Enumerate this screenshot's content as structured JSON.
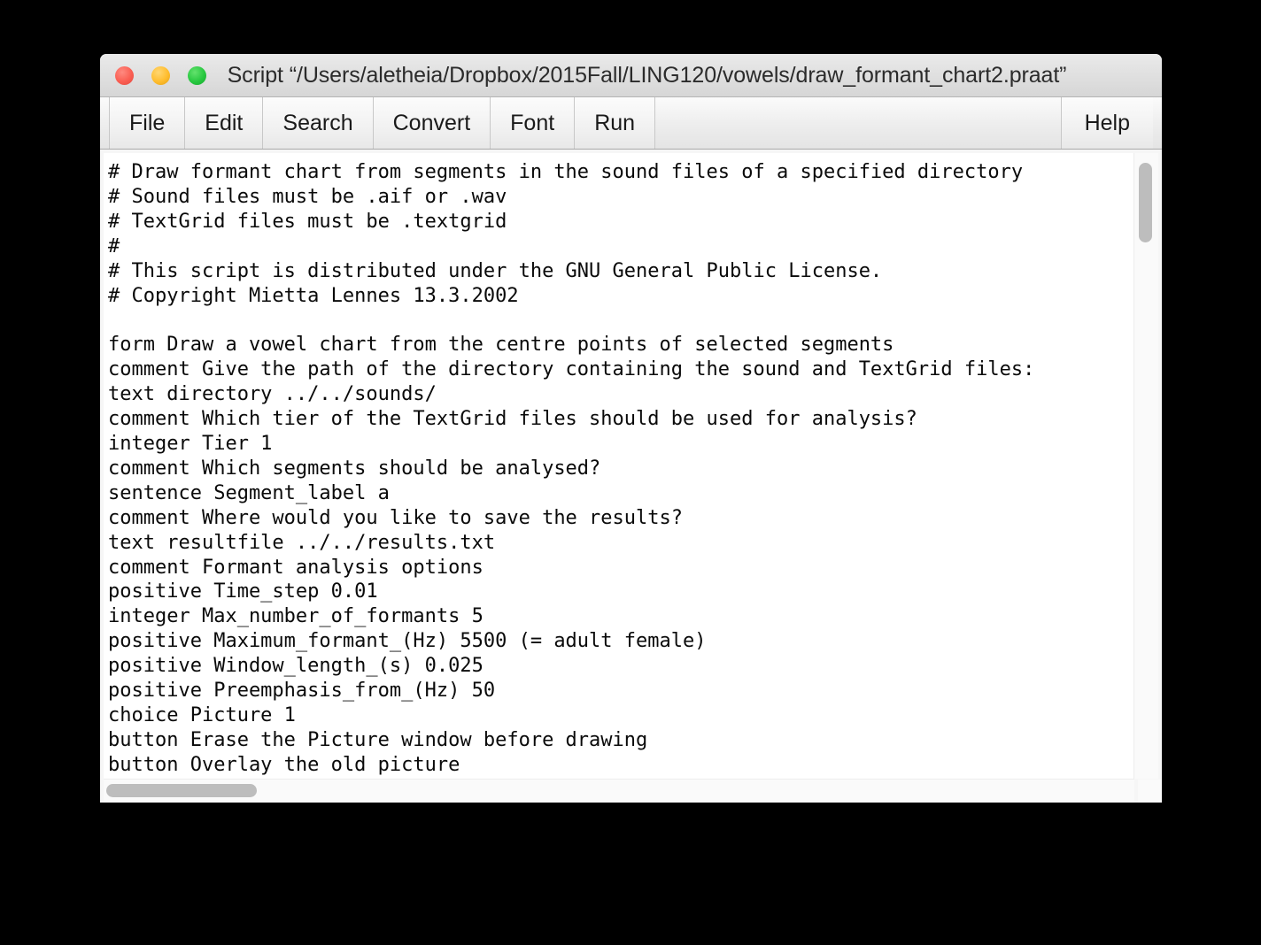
{
  "window": {
    "title": "Script “/Users/aletheia/Dropbox/2015Fall/LING120/vowels/draw_formant_chart2.praat”",
    "traffic_lights": {
      "close_label": "close",
      "minimize_label": "minimize",
      "zoom_label": "zoom",
      "close_color": "#fa5e52",
      "minimize_color": "#ffbd2e",
      "zoom_color": "#28c840"
    }
  },
  "menubar": {
    "items": [
      {
        "label": "File"
      },
      {
        "label": "Edit"
      },
      {
        "label": "Search"
      },
      {
        "label": "Convert"
      },
      {
        "label": "Font"
      },
      {
        "label": "Run"
      }
    ],
    "help": {
      "label": "Help"
    }
  },
  "editor": {
    "code": "# Draw formant chart from segments in the sound files of a specified directory\n# Sound files must be .aif or .wav\n# TextGrid files must be .textgrid\n#\n# This script is distributed under the GNU General Public License.\n# Copyright Mietta Lennes 13.3.2002\n\nform Draw a vowel chart from the centre points of selected segments\ncomment Give the path of the directory containing the sound and TextGrid files:\ntext directory ../../sounds/\ncomment Which tier of the TextGrid files should be used for analysis?\ninteger Tier 1\ncomment Which segments should be analysed?\nsentence Segment_label a\ncomment Where would you like to save the results?\ntext resultfile ../../results.txt\ncomment Formant analysis options\npositive Time_step 0.01\ninteger Max_number_of_formants 5\npositive Maximum_formant_(Hz) 5500 (= adult female)\npositive Window_length_(s) 0.025\npositive Preemphasis_from_(Hz) 50\nchoice Picture 1\nbutton Erase the Picture window before drawing\nbutton Overlay the old picture",
    "lines": [
      "# Draw formant chart from segments in the sound files of a specified directory",
      "# Sound files must be .aif or .wav",
      "# TextGrid files must be .textgrid",
      "#",
      "# This script is distributed under the GNU General Public License.",
      "# Copyright Mietta Lennes 13.3.2002",
      "",
      "form Draw a vowel chart from the centre points of selected segments",
      "comment Give the path of the directory containing the sound and TextGrid files:",
      "text directory ../../sounds/",
      "comment Which tier of the TextGrid files should be used for analysis?",
      "integer Tier 1",
      "comment Which segments should be analysed?",
      "sentence Segment_label a",
      "comment Where would you like to save the results?",
      "text resultfile ../../results.txt",
      "comment Formant analysis options",
      "positive Time_step 0.01",
      "integer Max_number_of_formants 5",
      "positive Maximum_formant_(Hz) 5500 (= adult female)",
      "positive Window_length_(s) 0.025",
      "positive Preemphasis_from_(Hz) 50",
      "choice Picture 1",
      "button Erase the Picture window before drawing",
      "button Overlay the old picture"
    ],
    "text_color": "#0a0a0a",
    "background_color": "#ffffff"
  },
  "scrollbars": {
    "vertical": {
      "name": "vertical-scrollbar",
      "thumb_color": "#bdbdbd"
    },
    "horizontal": {
      "name": "horizontal-scrollbar",
      "thumb_color": "#bdbdbd"
    }
  }
}
